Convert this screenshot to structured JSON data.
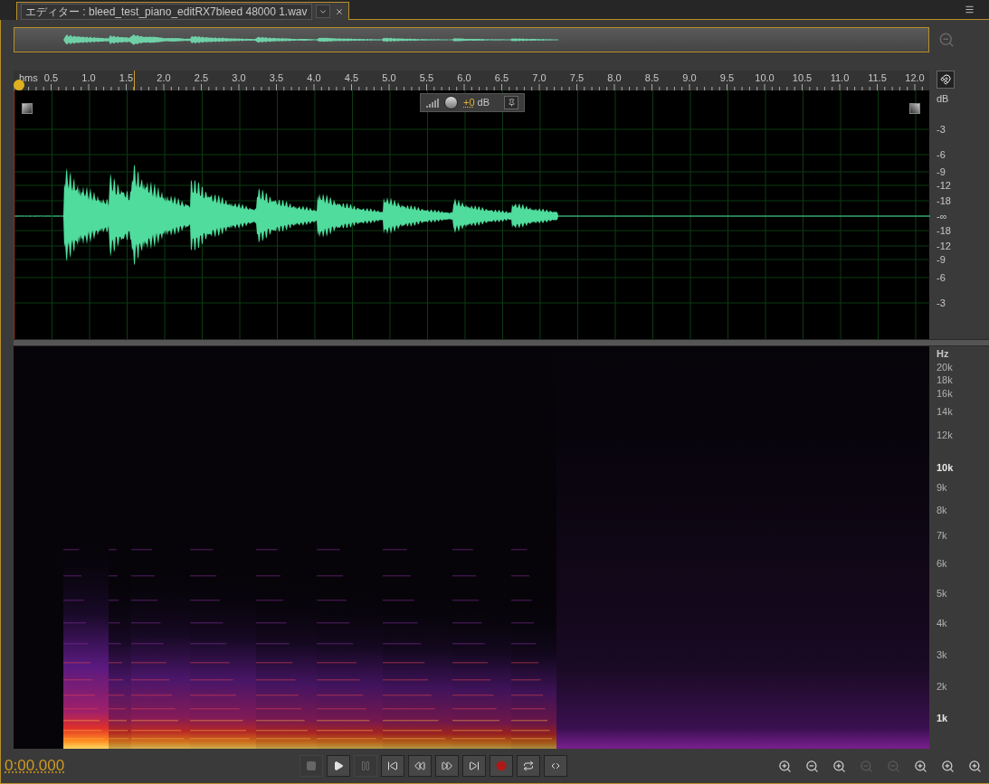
{
  "tab": {
    "title": "エディター : bleed_test_piano_editRX7bleed 48000 1.wav",
    "selected": true
  },
  "ruler": {
    "unit": "hms",
    "ticks": [
      "0.5",
      "1.0",
      "1.5",
      "2.0",
      "2.5",
      "3.0",
      "3.5",
      "4.0",
      "4.5",
      "5.0",
      "5.5",
      "6.0",
      "6.5",
      "7.0",
      "7.5",
      "8.0",
      "8.5",
      "9.0",
      "9.5",
      "10.0",
      "10.5",
      "11.0",
      "11.5",
      "12.0"
    ]
  },
  "hud": {
    "gain": "+0",
    "unit": "dB"
  },
  "amplitude_scale": {
    "unit": "dB",
    "labels": [
      "-3",
      "-6",
      "-9",
      "-12",
      "-18",
      "-∞",
      "-18",
      "-12",
      "-9",
      "-6",
      "-3"
    ]
  },
  "frequency_scale": {
    "unit": "Hz",
    "labels": [
      {
        "text": "20k",
        "bold": false
      },
      {
        "text": "18k",
        "bold": false
      },
      {
        "text": "16k",
        "bold": false
      },
      {
        "text": "14k",
        "bold": false
      },
      {
        "text": "12k",
        "bold": false
      },
      {
        "text": "10k",
        "bold": true
      },
      {
        "text": "9k",
        "bold": false
      },
      {
        "text": "8k",
        "bold": false
      },
      {
        "text": "7k",
        "bold": false
      },
      {
        "text": "6k",
        "bold": false
      },
      {
        "text": "5k",
        "bold": false
      },
      {
        "text": "4k",
        "bold": false
      },
      {
        "text": "3k",
        "bold": false
      },
      {
        "text": "2k",
        "bold": false
      },
      {
        "text": "1k",
        "bold": true
      }
    ]
  },
  "time_display": "0:00.000",
  "transport": [
    {
      "kind": "stop",
      "disabled": true
    },
    {
      "kind": "play",
      "disabled": false
    },
    {
      "kind": "pause",
      "disabled": true
    },
    {
      "kind": "start",
      "disabled": false
    },
    {
      "kind": "rewind",
      "disabled": false
    },
    {
      "kind": "forward",
      "disabled": false
    },
    {
      "kind": "end",
      "disabled": false
    },
    {
      "kind": "record",
      "disabled": false
    },
    {
      "kind": "loop",
      "disabled": false
    },
    {
      "kind": "skip",
      "disabled": false
    }
  ],
  "zoom_controls": [
    {
      "kind": "amp-in",
      "disabled": false
    },
    {
      "kind": "amp-out",
      "disabled": false
    },
    {
      "kind": "time-in",
      "disabled": false
    },
    {
      "kind": "time-out",
      "disabled": true
    },
    {
      "kind": "full",
      "disabled": true
    },
    {
      "kind": "in-point",
      "disabled": false
    },
    {
      "kind": "out-point",
      "disabled": false
    },
    {
      "kind": "selection",
      "disabled": false
    }
  ]
}
